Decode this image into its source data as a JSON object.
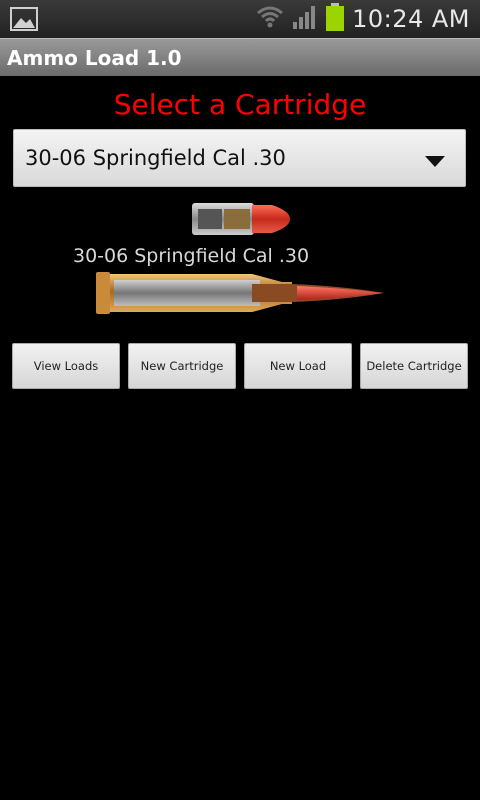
{
  "status_bar": {
    "time": "10:24 AM",
    "icons": [
      "gallery-icon",
      "wifi-icon",
      "signal-icon",
      "battery-icon"
    ]
  },
  "app": {
    "title": "Ammo Load 1.0"
  },
  "main": {
    "heading": "Select a Cartridge",
    "spinner": {
      "selected": "30-06 Springfield Cal .30"
    },
    "cartridge_label": "30-06 Springfield Cal .30",
    "buttons": {
      "view_loads": "View Loads",
      "new_cartridge": "New Cartridge",
      "new_load": "New Load",
      "delete_cartridge": "Delete Cartridge"
    }
  },
  "colors": {
    "heading": "#ff0000",
    "battery": "#9bd400",
    "background": "#000000"
  }
}
